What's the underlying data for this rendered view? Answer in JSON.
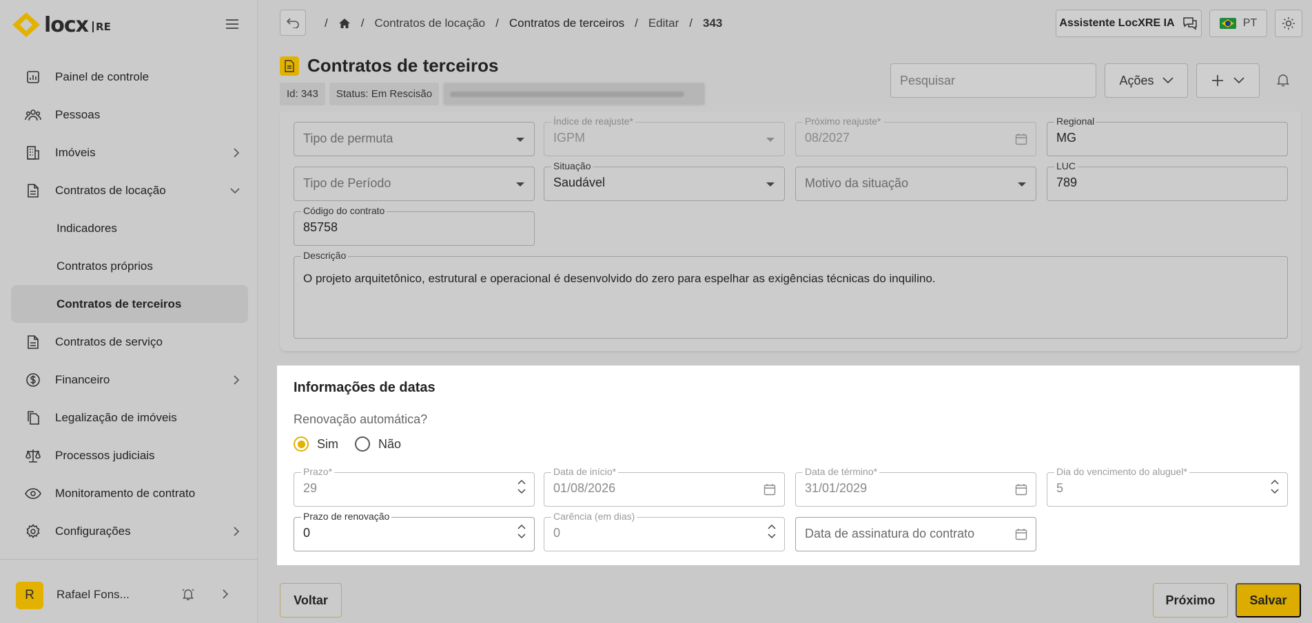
{
  "brand": {
    "name": "locx",
    "suffix": "RE"
  },
  "sidebar": {
    "items": [
      {
        "label": "Painel de controle",
        "icon": "chart-icon"
      },
      {
        "label": "Pessoas",
        "icon": "people-icon"
      },
      {
        "label": "Imóveis",
        "icon": "building-icon"
      },
      {
        "label": "Contratos de locação",
        "icon": "document-icon"
      },
      {
        "label": "Indicadores"
      },
      {
        "label": "Contratos próprios"
      },
      {
        "label": "Contratos de terceiros"
      },
      {
        "label": "Contratos de serviço",
        "icon": "document-icon"
      },
      {
        "label": "Financeiro",
        "icon": "dollar-icon"
      },
      {
        "label": "Legalização de imóveis",
        "icon": "files-icon"
      },
      {
        "label": "Processos judiciais",
        "icon": "scale-icon"
      },
      {
        "label": "Monitoramento de contrato",
        "icon": "eye-icon"
      },
      {
        "label": "Configurações",
        "icon": "gear-icon"
      }
    ],
    "user": {
      "initial": "R",
      "name": "Rafael Fons..."
    }
  },
  "breadcrumb": {
    "items": [
      "Contratos de locação",
      "Contratos de terceiros",
      "Editar",
      "343"
    ]
  },
  "topbar": {
    "assistant": "Assistente LocXRE IA",
    "language": "PT"
  },
  "page": {
    "title": "Contratos de terceiros",
    "badges": {
      "id": "Id: 343",
      "status": "Status: Em Rescisão"
    },
    "search_placeholder": "Pesquisar",
    "actions_label": "Ações"
  },
  "form": {
    "tipo_permuta": {
      "placeholder": "Tipo de permuta"
    },
    "indice_reajuste": {
      "label": "Índice de reajuste*",
      "value": "IGPM"
    },
    "proximo_reajuste": {
      "label": "Próximo reajuste*",
      "value": "08/2027"
    },
    "regional": {
      "label": "Regional",
      "value": "MG"
    },
    "tipo_periodo": {
      "placeholder": "Tipo de Período"
    },
    "situacao": {
      "label": "Situação",
      "value": "Saudável"
    },
    "motivo_situacao": {
      "placeholder": "Motivo da situação"
    },
    "luc": {
      "label": "LUC",
      "value": "789"
    },
    "codigo_contrato": {
      "label": "Código do contrato",
      "value": "85758"
    },
    "descricao": {
      "label": "Descrição",
      "value": "O projeto arquitetônico, estrutural e operacional é desenvolvido do zero para espelhar as exigências técnicas do inquilino."
    }
  },
  "dates": {
    "title": "Informações de datas",
    "auto_renew_question": "Renovação automática?",
    "options": [
      "Sim",
      "Não"
    ],
    "selected": "Sim",
    "prazo": {
      "label": "Prazo*",
      "value": "29"
    },
    "data_inicio": {
      "label": "Data de início*",
      "value": "01/08/2026"
    },
    "data_termino": {
      "label": "Data de término*",
      "value": "31/01/2029"
    },
    "dia_vencimento": {
      "label": "Dia do vencimento do aluguel*",
      "value": "5"
    },
    "prazo_renovacao": {
      "label": "Prazo de renovação",
      "value": "0"
    },
    "carencia": {
      "label": "Carência (em dias)",
      "value": "0"
    },
    "data_assinatura": {
      "placeholder": "Data de assinatura do contrato"
    }
  },
  "footer": {
    "back": "Voltar",
    "next": "Próximo",
    "save": "Salvar"
  },
  "colors": {
    "accent": "#dcac00",
    "highlight": "#ffffff",
    "background": "#c9c9c9"
  }
}
